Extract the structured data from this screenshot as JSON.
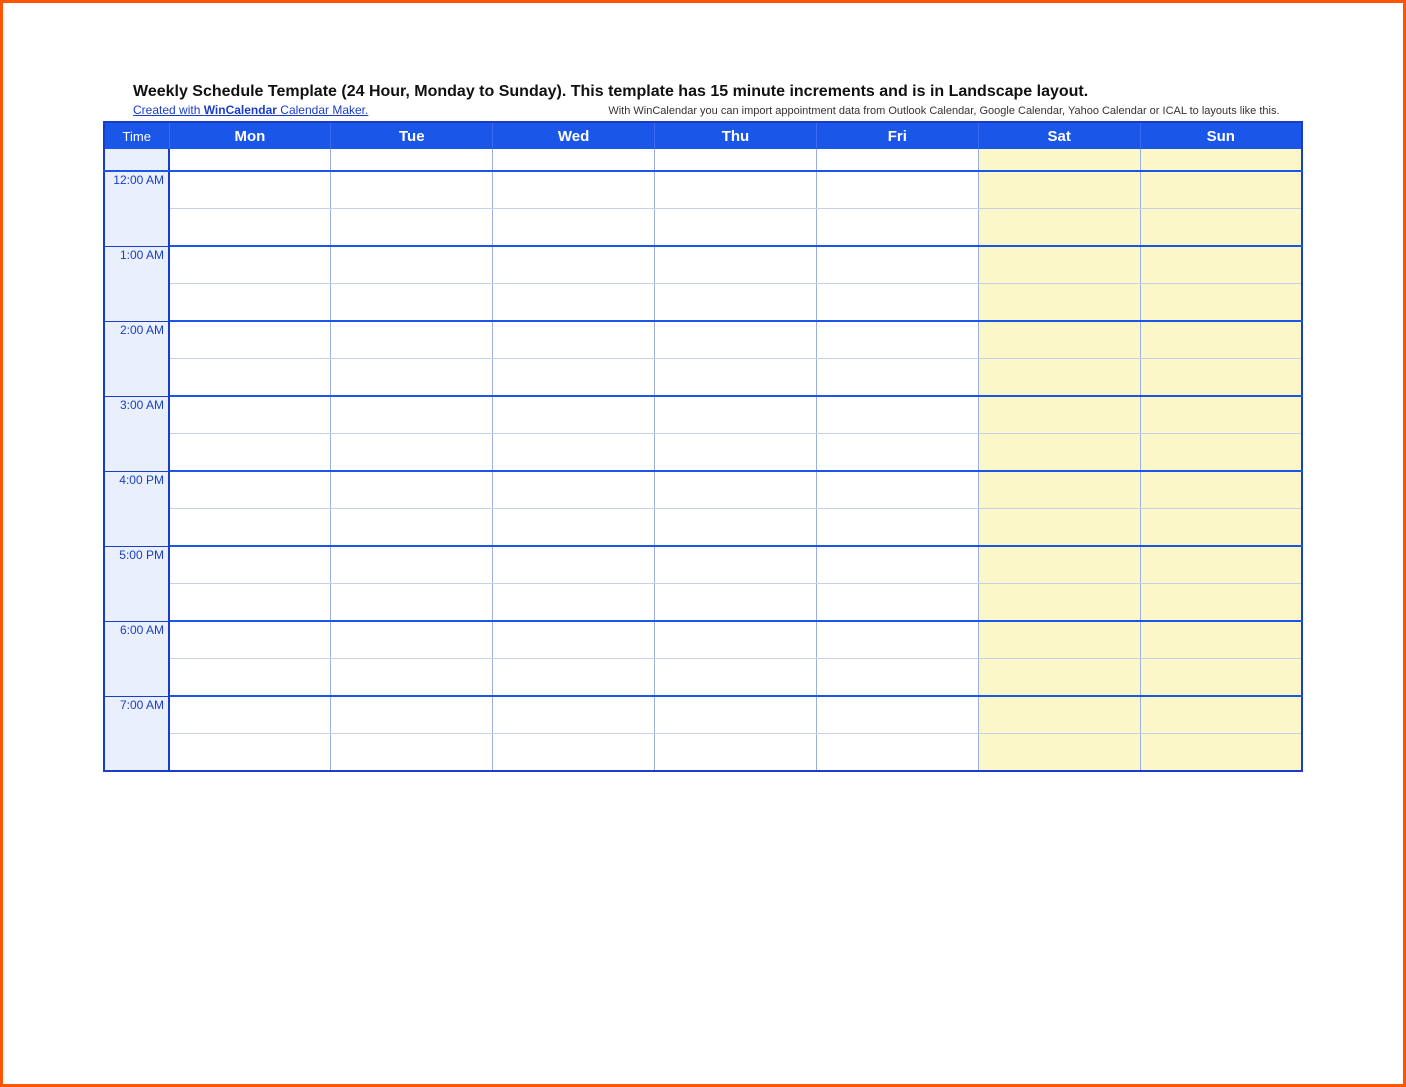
{
  "title": "Weekly Schedule Template (24 Hour, Monday to Sunday).  This template has 15 minute increments and is in Landscape layout.",
  "link": {
    "prefix": "Created with ",
    "bold": "WinCalendar",
    "suffix": " Calendar Maker."
  },
  "description": "With WinCalendar you can import appointment data from Outlook Calendar, Google Calendar, Yahoo Calendar or ICAL to layouts like this.",
  "header": {
    "time": "Time",
    "days": [
      "Mon",
      "Tue",
      "Wed",
      "Thu",
      "Fri",
      "Sat",
      "Sun"
    ]
  },
  "time_slots": [
    "12:00 AM",
    "1:00 AM",
    "2:00 AM",
    "3:00 AM",
    "4:00 PM",
    "5:00 PM",
    "6:00 AM",
    "7:00 AM"
  ],
  "weekend_indexes": [
    5,
    6
  ]
}
